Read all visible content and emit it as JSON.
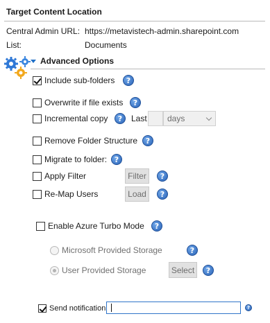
{
  "section": {
    "title": "Target Content Location",
    "fields": [
      {
        "label": "Central Admin URL:",
        "value": "https://metavistech-admin.sharepoint.com"
      },
      {
        "label": "List:",
        "value": "Documents"
      }
    ]
  },
  "advanced": {
    "title": "Advanced Options",
    "icon": "gears-icon",
    "options": {
      "include_subfolders": {
        "label": "Include sub-folders",
        "checked": true
      },
      "overwrite": {
        "label": "Overwrite if file exists",
        "checked": false
      },
      "incremental": {
        "label": "Incremental copy",
        "checked": false,
        "last_label": "Last",
        "unit": "days"
      },
      "remove_folder": {
        "label": "Remove Folder Structure",
        "checked": false
      },
      "migrate_folder": {
        "label": "Migrate to folder:",
        "checked": false
      },
      "apply_filter": {
        "label": "Apply Filter",
        "checked": false,
        "button": "Filter"
      },
      "remap_users": {
        "label": "Re-Map Users",
        "checked": false,
        "button": "Load"
      }
    },
    "azure": {
      "label": "Enable Azure Turbo Mode",
      "checked": false,
      "storage": {
        "microsoft": "Microsoft Provided Storage",
        "user": "User Provided Storage",
        "select_button": "Select",
        "selected": "user"
      }
    }
  },
  "notification": {
    "label": "Send notification",
    "checked": true,
    "value": ""
  },
  "colors": {
    "accent": "#1f6fc7",
    "help": "#2a63b7",
    "disabled_button": "#e1e1e1"
  }
}
